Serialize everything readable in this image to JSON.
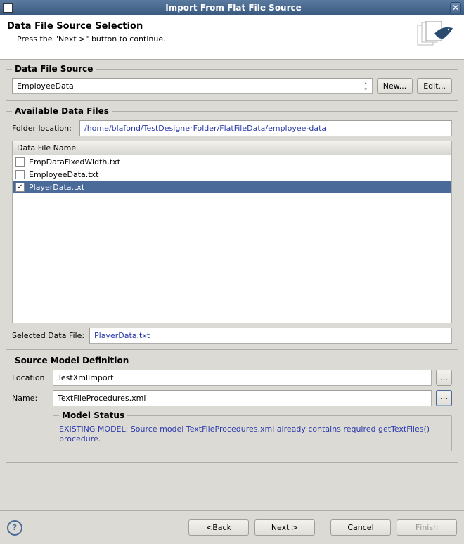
{
  "window": {
    "title": "Import From Flat File Source"
  },
  "header": {
    "title": "Data File Source Selection",
    "subtitle": "Press the \"Next >\" button to continue."
  },
  "dataFileSource": {
    "legend": "Data File Source",
    "selected": "EmployeeData",
    "newBtn": "New...",
    "editBtn": "Edit..."
  },
  "availableFiles": {
    "legend": "Available Data Files",
    "folderLabel": "Folder location:",
    "folderValue": "/home/blafond/TestDesignerFolder/FlatFileData/employee-data",
    "columnHeader": "Data File Name",
    "files": [
      {
        "name": "EmpDataFixedWidth.txt",
        "checked": false,
        "selected": false
      },
      {
        "name": "EmployeeData.txt",
        "checked": false,
        "selected": false
      },
      {
        "name": "PlayerData.txt",
        "checked": true,
        "selected": true
      }
    ],
    "selectedLabel": "Selected Data File:",
    "selectedValue": "PlayerData.txt"
  },
  "sourceModel": {
    "legend": "Source Model Definition",
    "locationLabel": "Location",
    "locationValue": "TestXmlImport",
    "nameLabel": "Name:",
    "nameValue": "TextFileProcedures.xmi",
    "modelStatusLegend": "Model Status",
    "modelStatusText": "EXISTING MODEL: Source model TextFileProcedures.xmi already contains required getTextFiles() procedure."
  },
  "footer": {
    "back": "Back",
    "next": "Next",
    "cancel": "Cancel",
    "finish": "Finish"
  }
}
